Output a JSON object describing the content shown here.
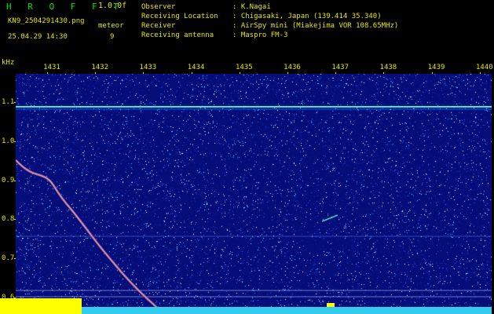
{
  "header": {
    "app_title": "H R O F F T",
    "version": "1.0.0f",
    "filename": "KN9_2504291430.png",
    "datetime": "25.04.29 14:30",
    "meteor_label": "meteor",
    "meteor_count": "9",
    "info": [
      {
        "key": "Observer",
        "value": ": K.Nagai"
      },
      {
        "key": "Receiving Location",
        "value": ": Chigasaki, Japan (139.414 35.340)"
      },
      {
        "key": "Receiver",
        "value": ": AirSpy mini (Miakejima VOR 108.65MHz)"
      },
      {
        "key": "Receiving antenna",
        "value": ": Maspro FM-3"
      }
    ]
  },
  "axes": {
    "unit": "kHz",
    "x_ticks": [
      "1431",
      "1432",
      "1433",
      "1434",
      "1435",
      "1436",
      "1437",
      "1438",
      "1439",
      "1440"
    ],
    "y_ticks": [
      "1.1",
      "1.0",
      "0.9",
      "0.8",
      "0.7",
      "0.6"
    ]
  },
  "colors": {
    "label_yellow": "#e6e600",
    "title_green": "#00e000",
    "plot_background": "#050d78",
    "signal_line": "#33ffcc",
    "bar_yellow": "#ffff00",
    "bar_cyan": "#33ccee"
  }
}
